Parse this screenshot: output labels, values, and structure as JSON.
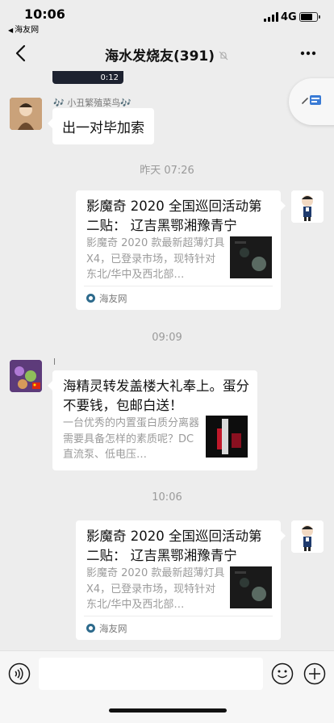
{
  "status_bar": {
    "time": "10:06",
    "back_to_app": "海友网",
    "network": "4G",
    "battery_level": 0.72
  },
  "nav": {
    "title": "海水发烧友(391)"
  },
  "chat": {
    "video": {
      "duration": "0:12"
    },
    "messages": [
      {
        "sender": "🎶 小丑繁殖菜鸟🎶",
        "text": "出一对毕加索"
      },
      {
        "timestamp": "昨天 07:26"
      },
      {
        "card": {
          "title": "影魔奇 2020 全国巡回活动第二贴： 辽吉黑鄂湘豫青宁",
          "desc": "影魔奇 2020 款最新超薄灯具 X4，已登录市场，现特针对东北/华中及西北部…",
          "source": "海友网"
        }
      },
      {
        "timestamp": "09:09"
      },
      {
        "sender": "l",
        "card": {
          "title": "海精灵转发盖楼大礼奉上。蛋分不要钱，包邮白送！",
          "desc": "一台优秀的内置蛋白质分离器需要具备怎样的素质呢？DC 直流泵、低电压…"
        }
      },
      {
        "timestamp": "10:06"
      },
      {
        "card": {
          "title": "影魔奇 2020 全国巡回活动第二贴： 辽吉黑鄂湘豫青宁",
          "desc": "影魔奇 2020 款最新超薄灯具 X4，已登录市场，现特针对东北/华中及西北部…",
          "source": "海友网"
        }
      }
    ]
  },
  "colors": {
    "background": "#ededed",
    "bubble": "#ffffff",
    "muted_text": "#9b9b9b"
  }
}
